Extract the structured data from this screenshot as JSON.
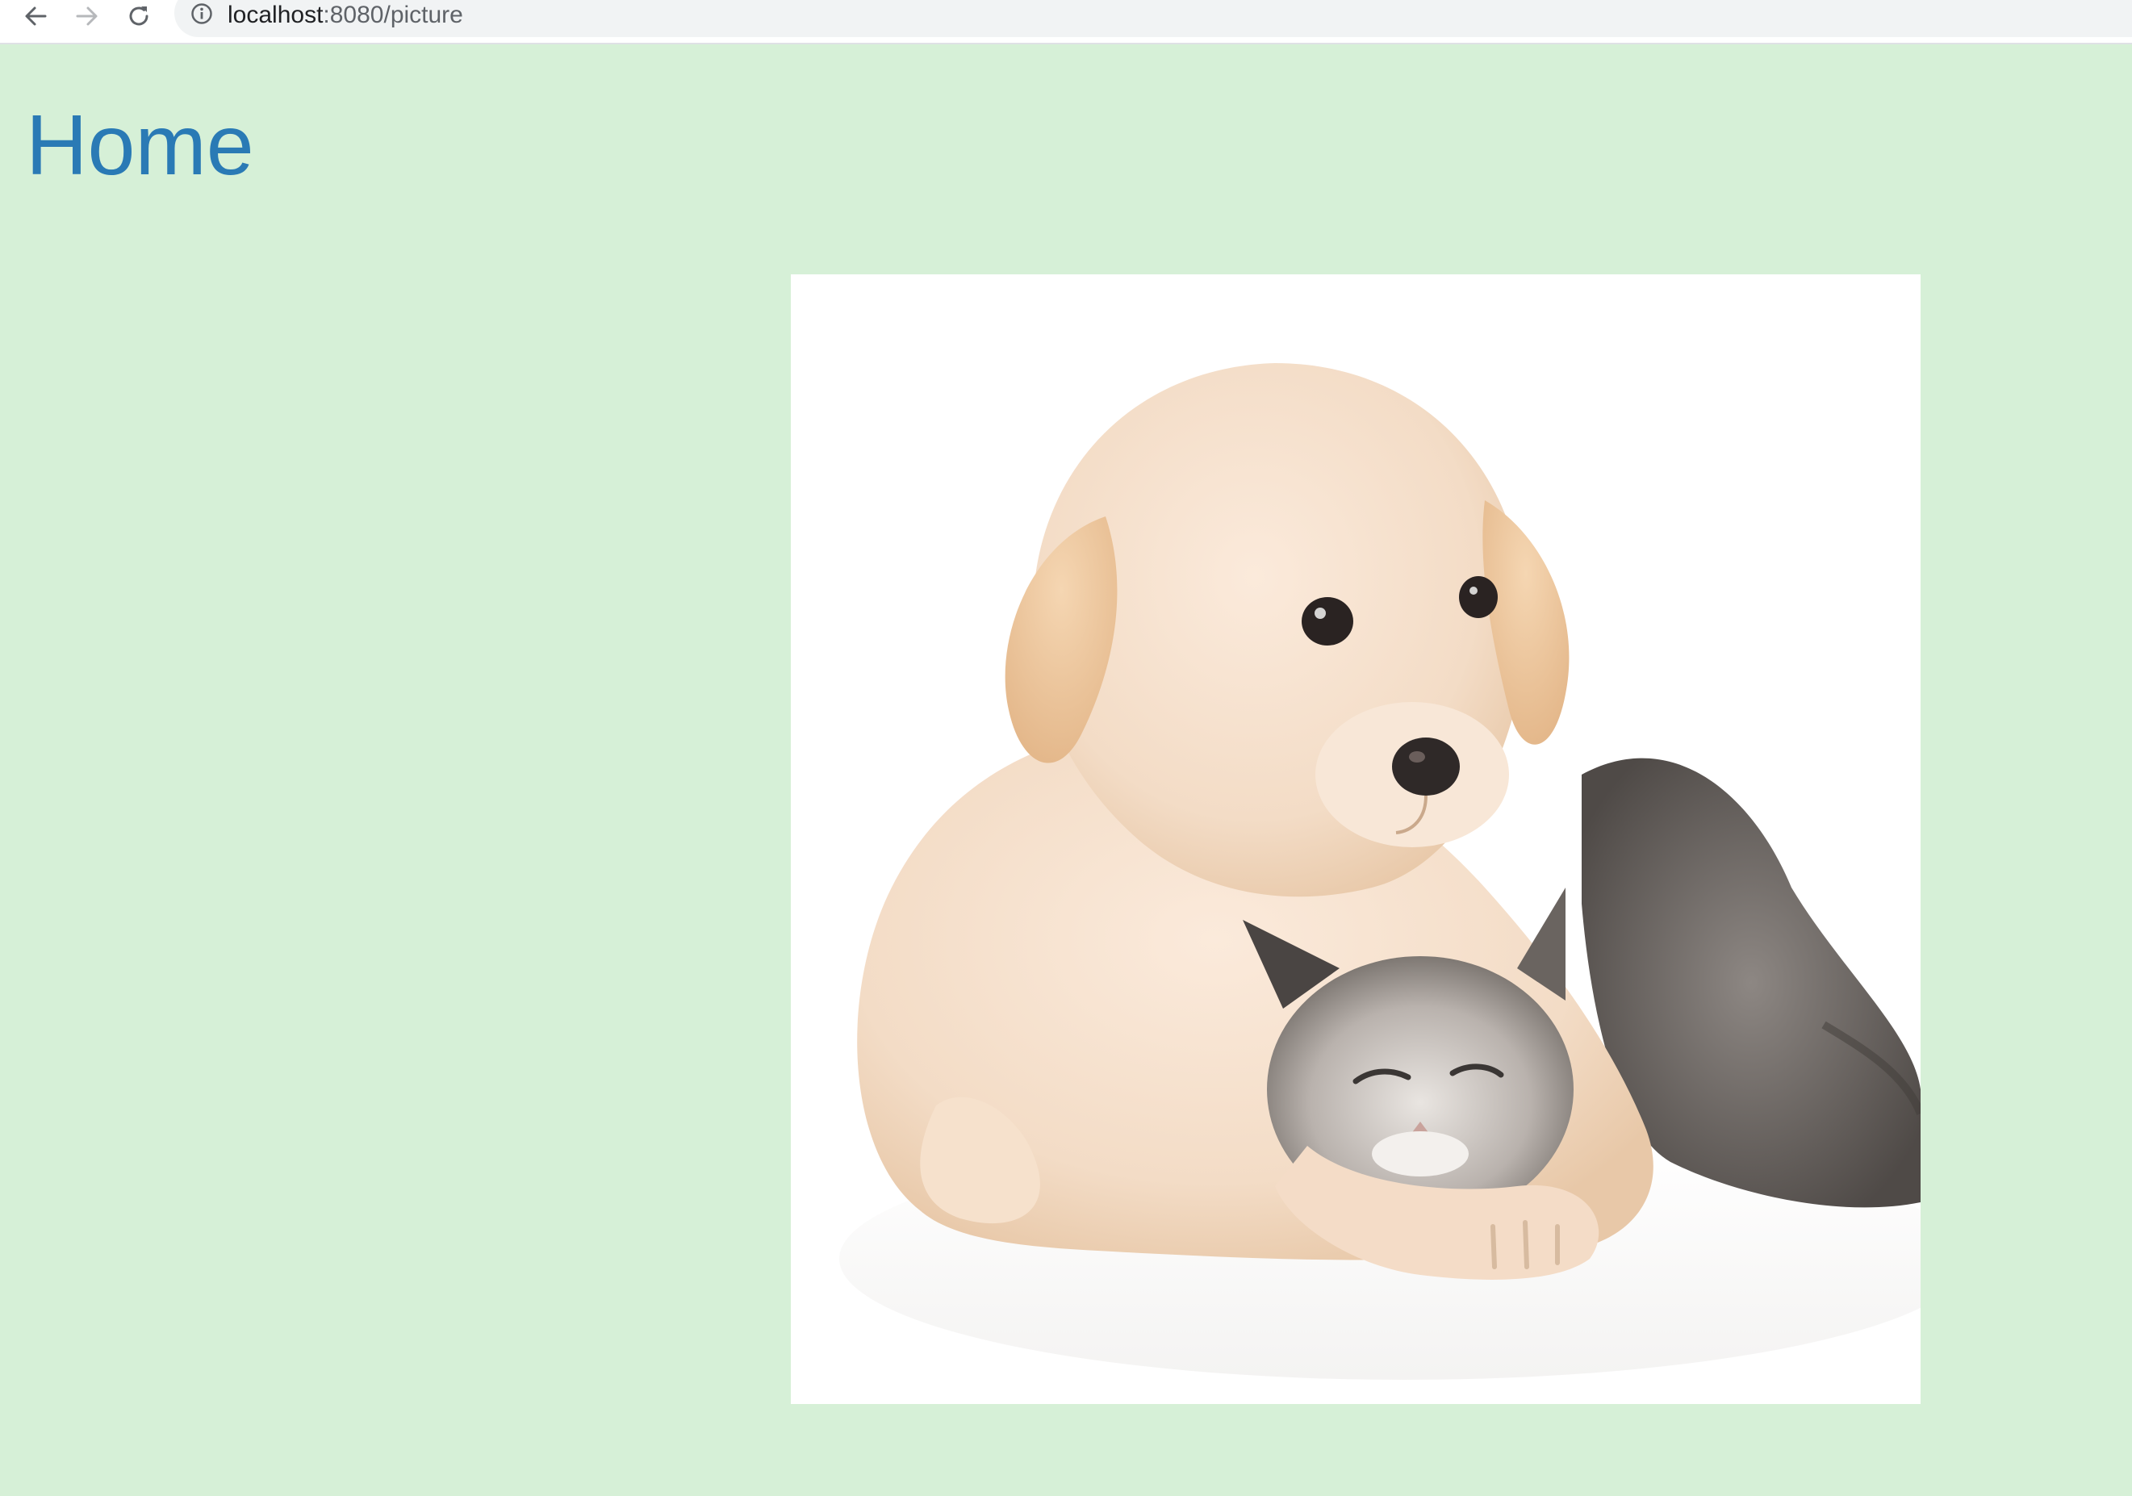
{
  "browser": {
    "url_host": "localhost",
    "url_rest": ":8080/picture",
    "back_icon": "arrow-left-icon",
    "forward_icon": "arrow-right-icon",
    "reload_icon": "reload-icon",
    "site_info_icon": "info-icon"
  },
  "page": {
    "title": "Home",
    "background_color": "#d6f0d7",
    "title_color": "#2a7ab5"
  },
  "picture": {
    "subject": "puppy hugging kitten photo"
  }
}
